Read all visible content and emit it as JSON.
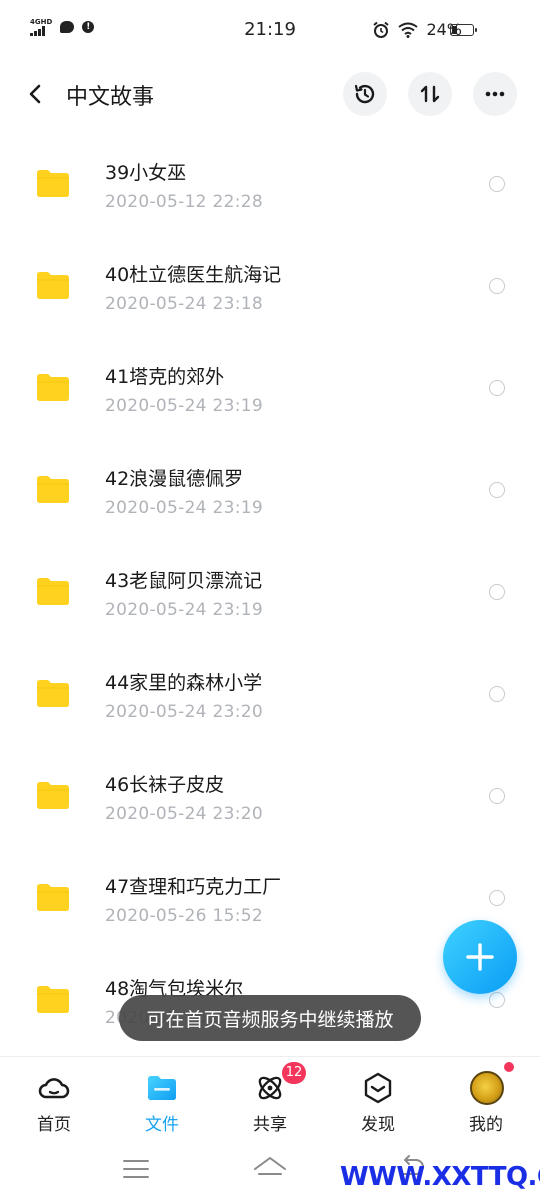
{
  "status_bar": {
    "network_label": "4GHD",
    "time": "21:19",
    "battery_percent": "24%",
    "battery_level": 0.24
  },
  "header": {
    "title": "中文故事",
    "back_icon": "chevron-left-icon",
    "history_icon": "history-icon",
    "sort_icon": "sort-icon",
    "more_icon": "more-icon"
  },
  "files": [
    {
      "name": "39小女巫",
      "date": "2020-05-12  22:28"
    },
    {
      "name": "40杜立德医生航海记",
      "date": "2020-05-24  23:18"
    },
    {
      "name": "41塔克的郊外",
      "date": "2020-05-24  23:19"
    },
    {
      "name": "42浪漫鼠德佩罗",
      "date": "2020-05-24  23:19"
    },
    {
      "name": "43老鼠阿贝漂流记",
      "date": "2020-05-24  23:19"
    },
    {
      "name": "44家里的森林小学",
      "date": "2020-05-24  23:20"
    },
    {
      "name": "46长袜子皮皮",
      "date": "2020-05-24  23:20"
    },
    {
      "name": "47查理和巧克力工厂",
      "date": "2020-05-26  15:52"
    },
    {
      "name": "48淘气包埃米尔",
      "date": "2020-05-26  15:52"
    }
  ],
  "toast": "可在首页音频服务中继续播放",
  "bottom_nav": [
    {
      "label": "首页",
      "icon": "cloud-icon",
      "active": false
    },
    {
      "label": "文件",
      "icon": "folder-icon",
      "active": true
    },
    {
      "label": "共享",
      "icon": "atom-icon",
      "active": false,
      "badge": "12"
    },
    {
      "label": "发现",
      "icon": "cube-icon",
      "active": false
    },
    {
      "label": "我的",
      "icon": "avatar",
      "active": false,
      "dot": true
    }
  ],
  "watermark": "WWW.XXTTQ.COM",
  "colors": {
    "accent": "#16a3f0",
    "folder": "#ffd21f",
    "badge": "#f5365c",
    "watermark": "#1a2ee6"
  }
}
